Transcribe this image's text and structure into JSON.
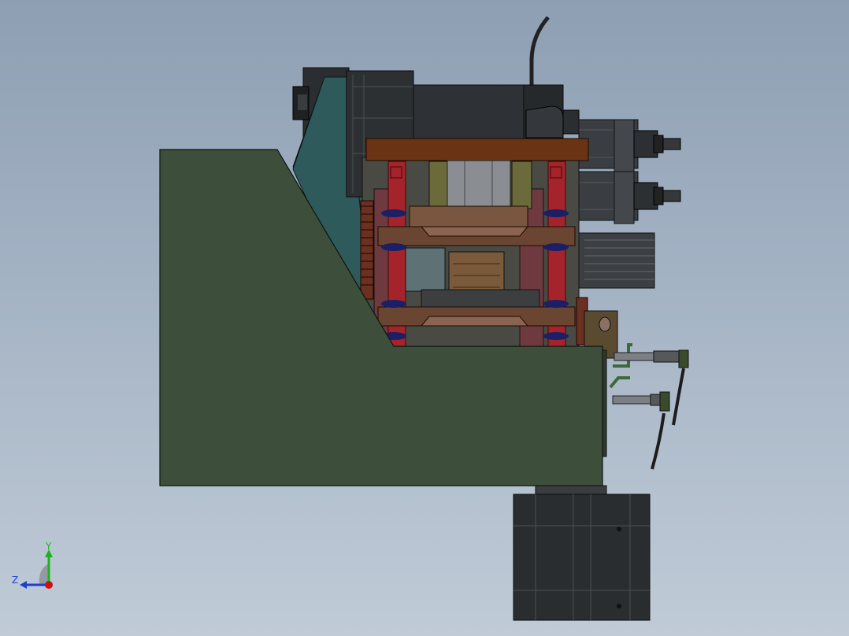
{
  "viewport": {
    "background_top": "#8e9fb3",
    "background_bottom": "#c0cbd7"
  },
  "model": {
    "base_color": "#3d4f3a",
    "plate_color": "#2e5a5b",
    "motor_color": "#2f3336",
    "guide_post_color": "#a5232a",
    "clamp_color": "#6a4632"
  },
  "triad": {
    "y_label": "Y",
    "z_label": "Z",
    "y_color": "#1fb01f",
    "z_color": "#1f3fd0",
    "x_color": "#d01010"
  }
}
